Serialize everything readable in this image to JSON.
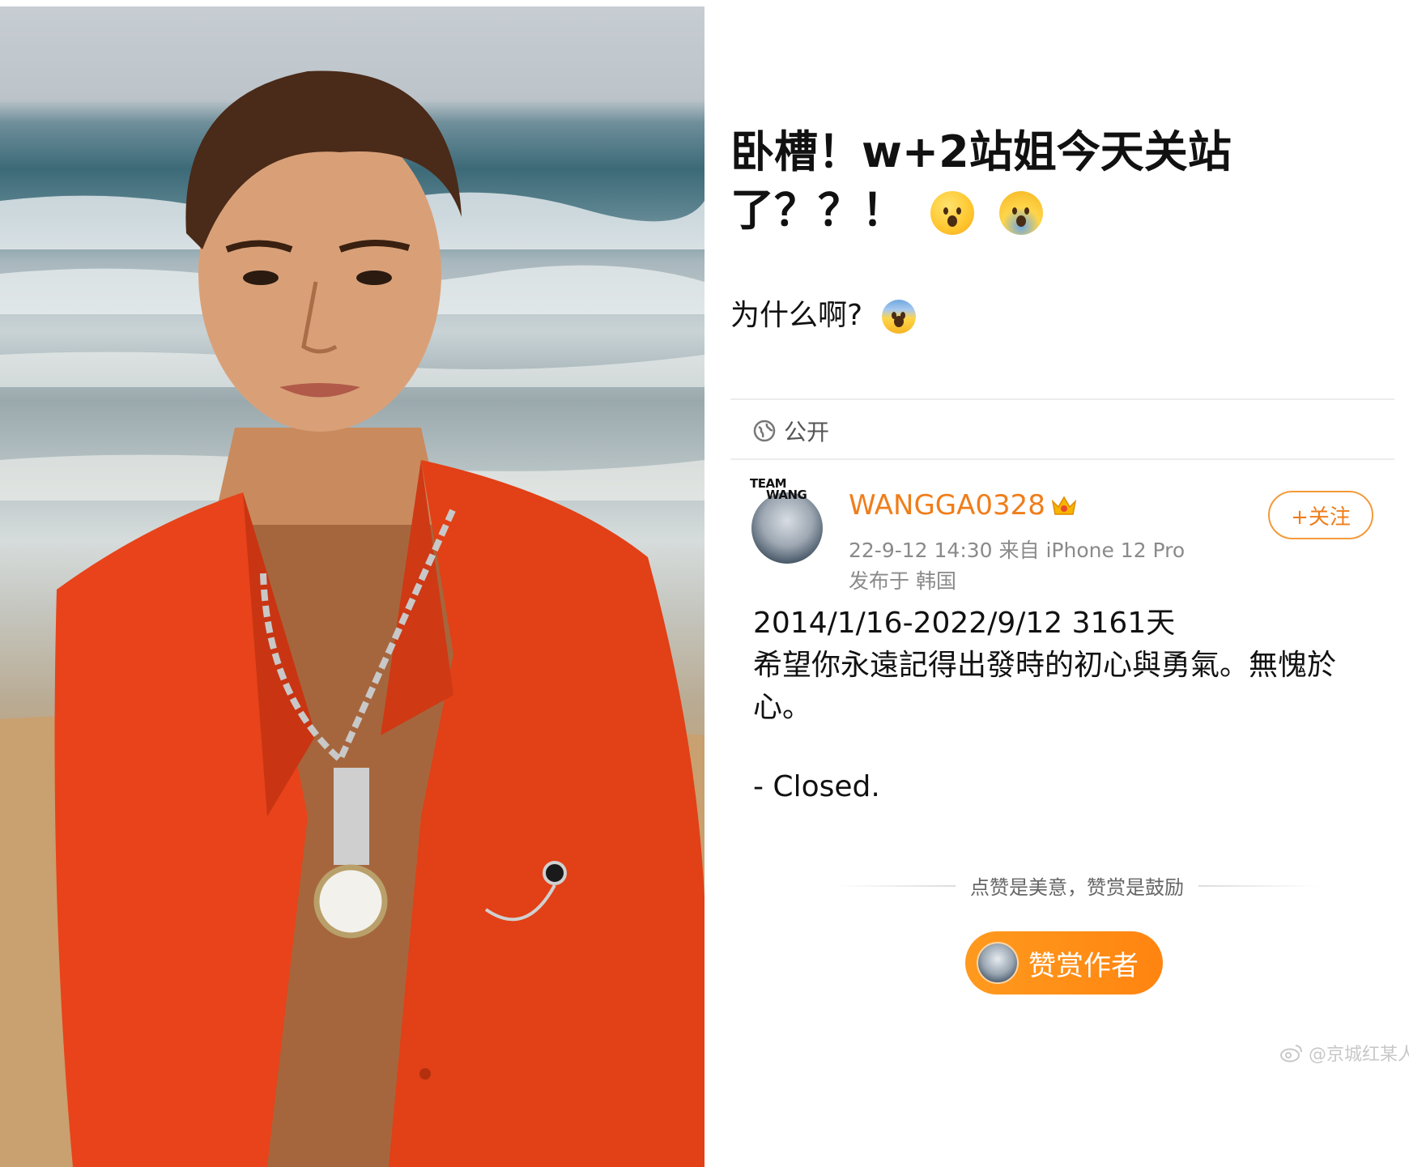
{
  "post": {
    "title_line1": "卧槽！w+2站姐今天关站",
    "title_line2": "了？？！",
    "title_emojis": [
      "astonished-face-emoji",
      "face-screaming-in-fear-emoji"
    ],
    "subtitle": "为什么啊?",
    "subtitle_emoji": "fearful-face-emoji",
    "visibility": "公开",
    "quoted": {
      "avatar_badge_line1": "TEAM",
      "avatar_badge_line2": "WANG",
      "username": "WANGGA0328",
      "timestamp_source": "22-9-12 14:30   来自 iPhone 12 Pro",
      "location": "发布于 韩国",
      "follow_label": "+关注",
      "body_line1": "2014/1/16-2022/9/12 3161天",
      "body_line2": "希望你永遠記得出發時的初心與勇氣。無愧於",
      "body_line3": "心。",
      "closing": "- Closed.",
      "reward_hint": "点赞是美意，赞赏是鼓励",
      "reward_button": "赞赏作者"
    },
    "watermark": "@京城红某人"
  },
  "colors": {
    "accent_orange": "#f07d1a",
    "reward_button": "#ff8f16",
    "jacket_red": "#e8431a"
  }
}
